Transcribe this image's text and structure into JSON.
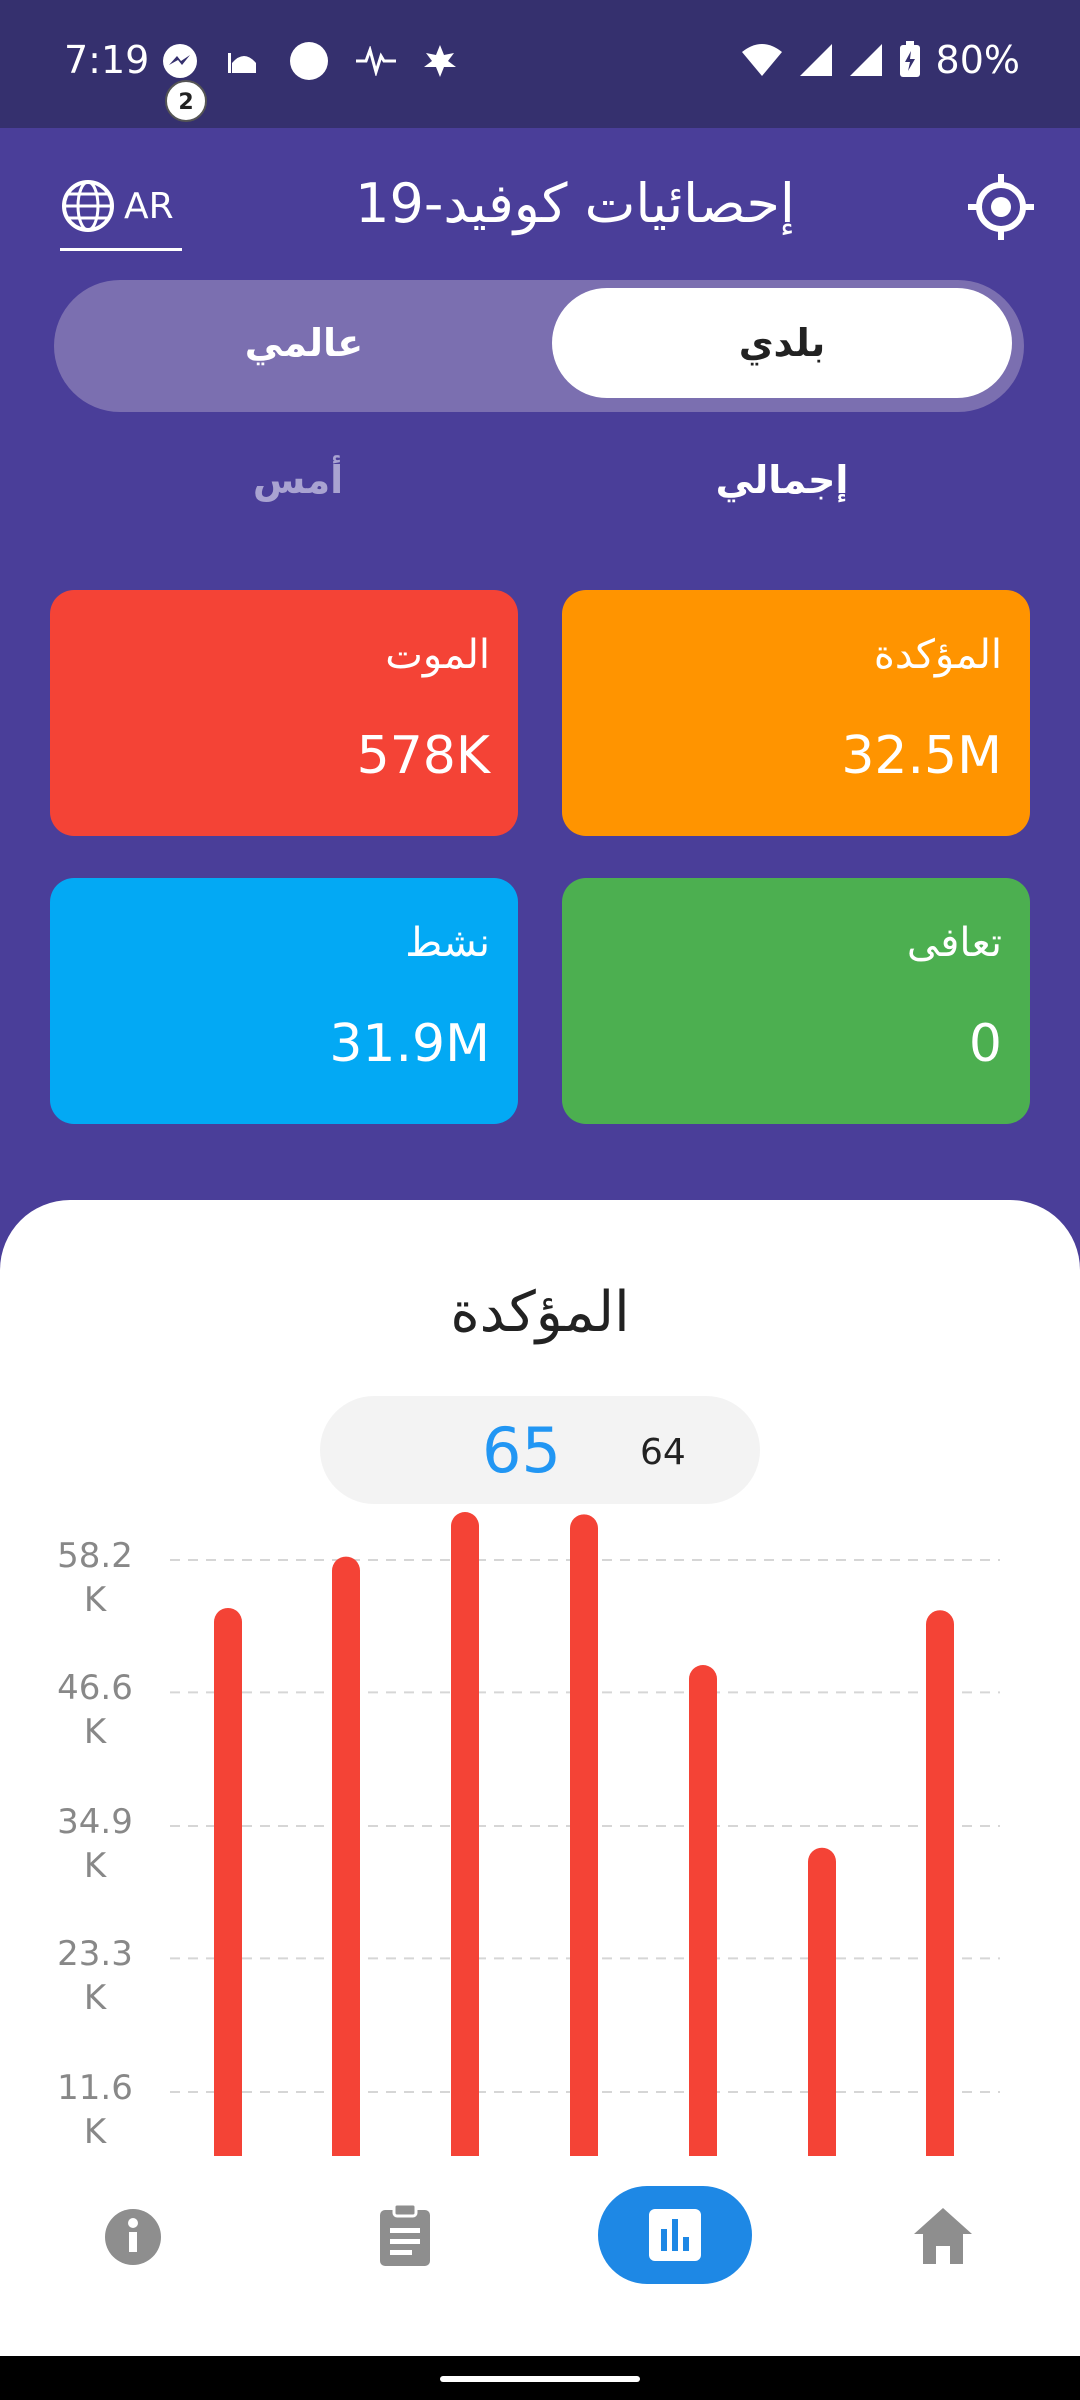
{
  "status_bar": {
    "time": "7:19",
    "notification_badge": "2",
    "battery": "80%"
  },
  "header": {
    "language": "AR",
    "title": "إحصائيات كوفيد-19"
  },
  "segment": {
    "global": "عالمي",
    "local": "بلدي"
  },
  "tabs": {
    "yesterday": "أمس",
    "total": "إجمالي"
  },
  "cards": {
    "confirmed": {
      "label": "المؤكدة",
      "value": "32.5M",
      "color": "#ff9400"
    },
    "death": {
      "label": "الموت",
      "value": "578K",
      "color": "#f44336"
    },
    "recovered": {
      "label": "تعافى",
      "value": "0",
      "color": "#4caf50"
    },
    "active": {
      "label": "نشط",
      "value": "31.9M",
      "color": "#03a9f4"
    }
  },
  "chart_section": {
    "title": "المؤكدة",
    "selected": "65",
    "previous": "64"
  },
  "chart_data": {
    "type": "bar",
    "title": "المؤكدة",
    "y_ticks": [
      {
        "label_top": "58.2",
        "label_bottom": "K",
        "value": 58200
      },
      {
        "label_top": "46.6",
        "label_bottom": "K",
        "value": 46600
      },
      {
        "label_top": "34.9",
        "label_bottom": "K",
        "value": 34900
      },
      {
        "label_top": "23.3",
        "label_bottom": "K",
        "value": 23300
      },
      {
        "label_top": "11.6",
        "label_bottom": "K",
        "value": 11600
      }
    ],
    "values": [
      54000,
      58500,
      62400,
      62200,
      49000,
      33000,
      53800
    ],
    "ylim": [
      0,
      62400
    ],
    "bar_color": "#f44336",
    "grid": true
  },
  "bottom_nav": {
    "items": [
      "info-icon",
      "clipboard-icon",
      "bar-chart-icon",
      "home-icon"
    ],
    "active": "bar-chart-icon",
    "active_color": "#1e88e5"
  }
}
